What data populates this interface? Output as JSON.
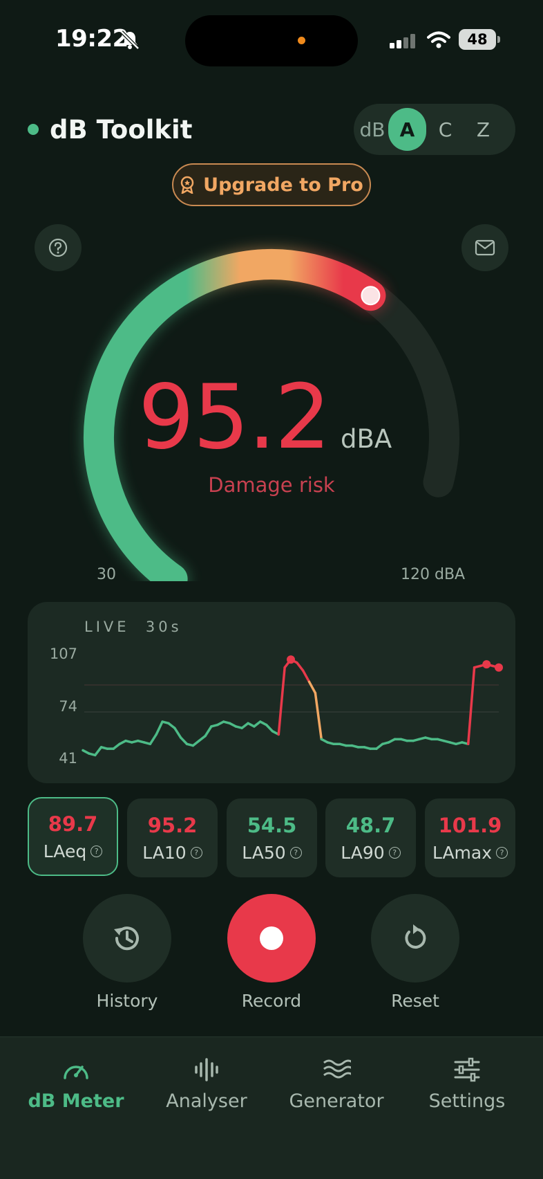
{
  "status_bar": {
    "time": "19:22",
    "battery": "48"
  },
  "header": {
    "app_name": "dB Toolkit",
    "weighting_label": "dB",
    "weightings": [
      "A",
      "C",
      "Z"
    ],
    "selected_weighting": "A",
    "upgrade_label": "Upgrade to Pro"
  },
  "gauge": {
    "value": "95.2",
    "unit": "dBA",
    "status": "Damage risk",
    "min_label": "30",
    "max_label": "120 dBA",
    "fraction": 0.72
  },
  "live_chart": {
    "label": "LIVE",
    "window": "30s",
    "y_ticks": [
      "107",
      "74",
      "41"
    ]
  },
  "chart_data": {
    "type": "line",
    "ylim": [
      41,
      107
    ],
    "y_ticks": [
      107,
      74,
      41
    ],
    "series": [
      {
        "values": [
          46,
          44,
          43,
          48,
          47,
          47,
          50,
          52,
          51,
          52,
          51,
          50,
          56,
          64,
          63,
          60,
          54,
          50,
          49,
          52,
          55,
          61,
          62,
          64,
          63,
          61,
          60,
          63,
          61,
          64,
          62,
          58,
          56,
          98,
          103,
          101,
          96,
          89,
          82,
          53,
          51,
          50,
          50,
          49,
          49,
          48,
          48,
          47,
          47,
          50,
          51,
          53,
          53,
          52,
          52,
          53,
          54,
          53,
          53,
          52,
          51,
          50,
          51,
          50,
          98,
          99,
          100,
          99,
          98
        ]
      }
    ]
  },
  "stats": [
    {
      "value": "89.7",
      "label": "LAeq",
      "color": "red",
      "selected": true
    },
    {
      "value": "95.2",
      "label": "LA10",
      "color": "red",
      "selected": false
    },
    {
      "value": "54.5",
      "label": "LA50",
      "color": "green",
      "selected": false
    },
    {
      "value": "48.7",
      "label": "LA90",
      "color": "green",
      "selected": false
    },
    {
      "value": "101.9",
      "label": "LAmax",
      "color": "red",
      "selected": false
    }
  ],
  "actions": {
    "history": "History",
    "record": "Record",
    "reset": "Reset"
  },
  "tabs": [
    {
      "label": "dB Meter",
      "icon": "gauge-icon",
      "active": true
    },
    {
      "label": "Analyser",
      "icon": "waveform-icon",
      "active": false
    },
    {
      "label": "Generator",
      "icon": "waves-icon",
      "active": false
    },
    {
      "label": "Settings",
      "icon": "sliders-icon",
      "active": false
    }
  ],
  "colors": {
    "accent": "#4dbb87",
    "danger": "#e8394a",
    "warning": "#f1a763",
    "background": "#0f1a15"
  }
}
